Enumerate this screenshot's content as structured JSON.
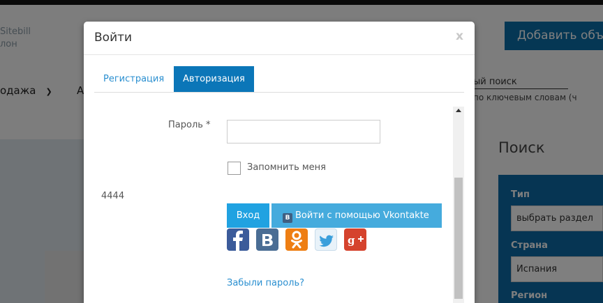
{
  "background": {
    "logo_line1": "Sitebill",
    "logo_line2": "лон",
    "add_button": "Добавить объ",
    "nav_item": "одажа",
    "nav_next": "А",
    "search_title": "ый поиск",
    "search_sub": "по ключевым словам (ч",
    "panel_title": "Поиск",
    "filters": [
      {
        "label": "Тип",
        "value": "выбрать раздел"
      },
      {
        "label": "Страна",
        "value": "Испания"
      },
      {
        "label": "Регион",
        "value": ""
      }
    ]
  },
  "modal": {
    "title": "Войти",
    "close": "x",
    "tabs": [
      {
        "label": "Регистрация",
        "active": false
      },
      {
        "label": "Авторизация",
        "active": true
      }
    ],
    "password_label": "Пароль *",
    "password_value": "",
    "remember_label": "Запомнить меня",
    "remember_checked": false,
    "side_number": "4444",
    "login_button": "Вход",
    "vk_badge": "B",
    "vk_button": "Войти с помощью Vkontakte",
    "social_icons": [
      "facebook-icon",
      "vkontakte-icon",
      "odnoklassniki-icon",
      "twitter-icon",
      "google-plus-icon"
    ],
    "forgot_link": "Забыли пароль?"
  },
  "colors": {
    "tab_active": "#0b76b8",
    "login_button": "#20a2e1",
    "vk_button": "#45abdd",
    "link": "#2a8fd0"
  }
}
